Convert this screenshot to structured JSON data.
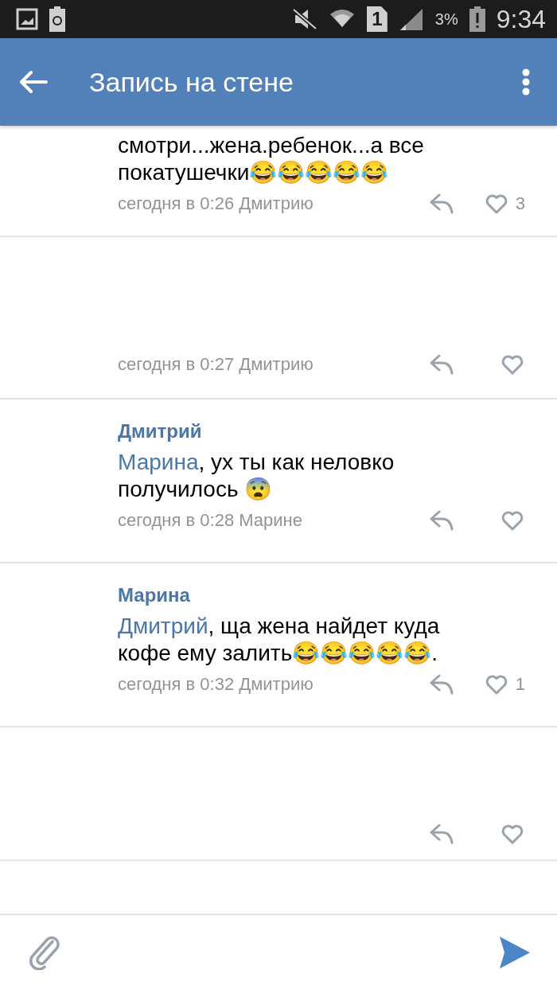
{
  "status_bar": {
    "sim": "1",
    "battery": "3%",
    "time": "9:34"
  },
  "app_bar": {
    "title": "Запись на стене"
  },
  "comments": [
    {
      "kind": "cut",
      "text": "смотри...жена.ребенок...а все покатушечки😂😂😂😂😂",
      "time": "сегодня в 0:26 Дмитрию",
      "likes": "3"
    },
    {
      "kind": "hidden",
      "time": "сегодня в 0:27 Дмитрию"
    },
    {
      "kind": "full",
      "author": "Дмитрий",
      "reply_to": "Марина",
      "text": ", ух ты как неловко получилось 😨",
      "time": "сегодня в 0:28 Марине"
    },
    {
      "kind": "full",
      "author": "Марина",
      "reply_to": "Дмитрий",
      "text": ", ща жена найдет куда кофе ему залить😂😂😂😂😂.",
      "time": "сегодня в 0:32 Дмитрию",
      "likes": "1"
    },
    {
      "kind": "hidden"
    }
  ]
}
